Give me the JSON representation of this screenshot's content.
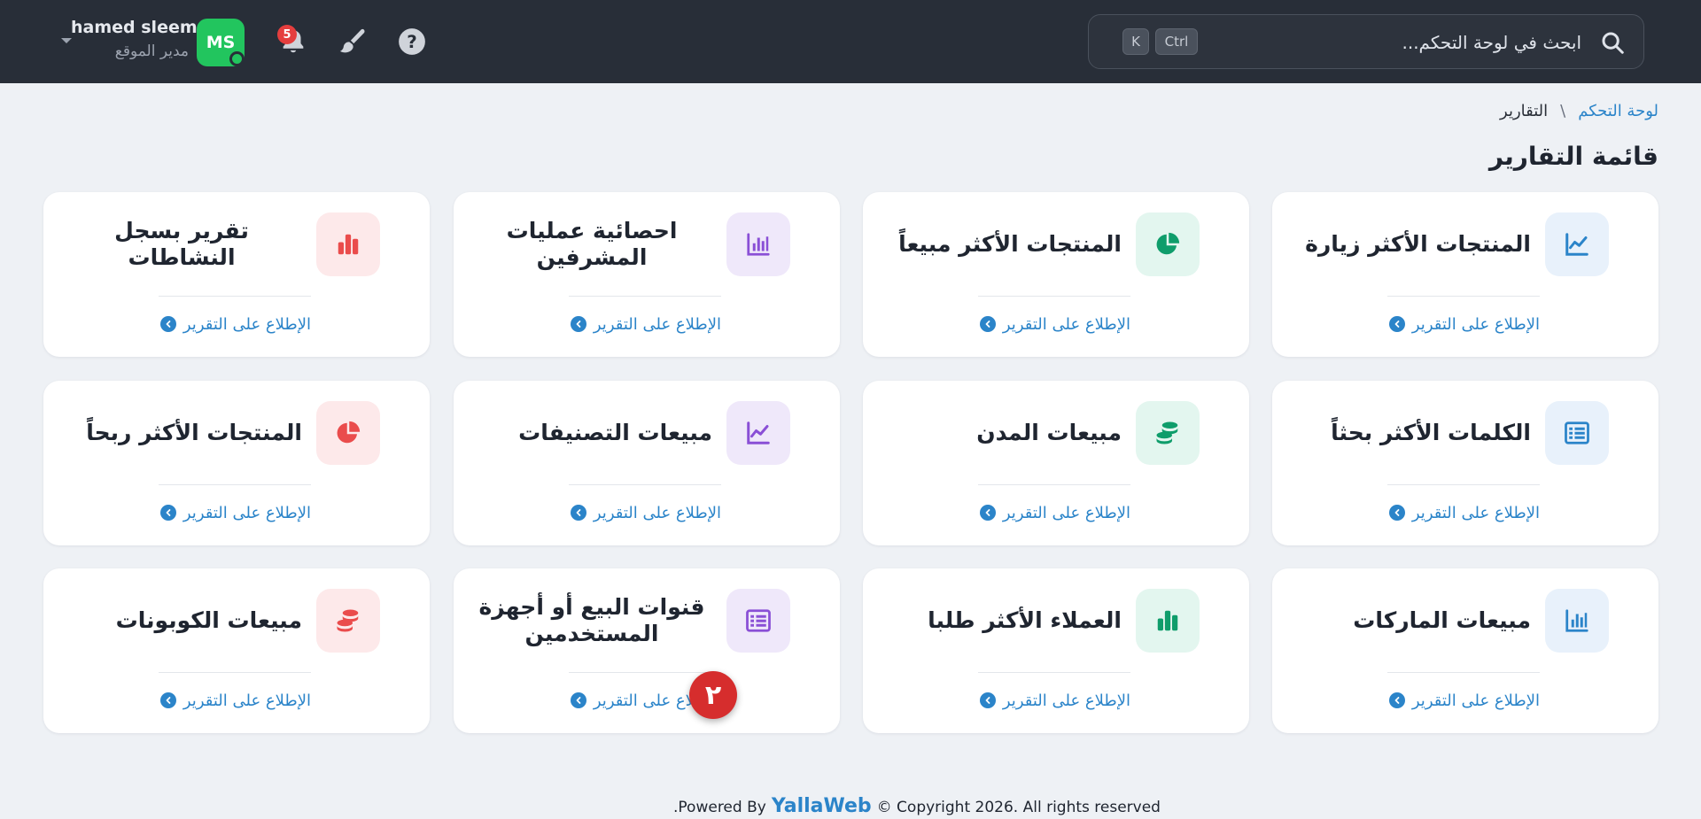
{
  "topbar": {
    "search_placeholder": "ابحث في لوحة التحكم...",
    "kbd_ctrl": "Ctrl",
    "kbd_k": "K",
    "notification_count": "5",
    "user": {
      "initials": "MS",
      "name": "hamed sleem",
      "role": "مدير الموقع"
    }
  },
  "breadcrumb": {
    "home": "لوحة التحكم",
    "separator": "\\",
    "current": "التقارير"
  },
  "page_title": "قائمة التقارير",
  "cards": [
    {
      "title": "المنتجات الأكثر زيارة",
      "icon": "line-chart-icon",
      "tone": "blue",
      "link": "الإطلاع على التقرير"
    },
    {
      "title": "المنتجات الأكثر مبيعاً",
      "icon": "pie-chart-icon",
      "tone": "green",
      "link": "الإطلاع على التقرير"
    },
    {
      "title": "احصائية عمليات المشرفين",
      "icon": "bar-chart-icon",
      "tone": "purple",
      "link": "الإطلاع على التقرير"
    },
    {
      "title": "تقرير بسجل النشاطات",
      "icon": "column-chart-icon",
      "tone": "red",
      "link": "الإطلاع على التقرير"
    },
    {
      "title": "الكلمات الأكثر بحثاً",
      "icon": "list-icon",
      "tone": "blue",
      "link": "الإطلاع على التقرير"
    },
    {
      "title": "مبيعات المدن",
      "icon": "coins-icon",
      "tone": "green",
      "link": "الإطلاع على التقرير"
    },
    {
      "title": "مبيعات التصنيفات",
      "icon": "line-chart-icon",
      "tone": "purple",
      "link": "الإطلاع على التقرير"
    },
    {
      "title": "المنتجات الأكثر ربحاً",
      "icon": "pie-chart-icon",
      "tone": "red",
      "link": "الإطلاع على التقرير"
    },
    {
      "title": "مبيعات الماركات",
      "icon": "bar-chart-icon",
      "tone": "blue",
      "link": "الإطلاع على التقرير"
    },
    {
      "title": "العملاء الأكثر طلبا",
      "icon": "column-chart-icon",
      "tone": "green",
      "link": "الإطلاع على التقرير"
    },
    {
      "title": "قنوات البيع أو أجهزة المستخدمين",
      "icon": "list-icon",
      "tone": "purple",
      "link": "الإطلاع على التقرير"
    },
    {
      "title": "مبيعات الكوبونات",
      "icon": "coins-icon",
      "tone": "red",
      "link": "الإطلاع على التقرير"
    }
  ],
  "tone_colors": {
    "blue": "#2b84c9",
    "green": "#0f9d6b",
    "purple": "#8a4fd6",
    "red": "#ea4c4c"
  },
  "marker": "٢",
  "footer": {
    "prefix": ".Powered By",
    "brand": "YallaWeb",
    "suffix": "© Copyright 2026. All rights reserved"
  }
}
